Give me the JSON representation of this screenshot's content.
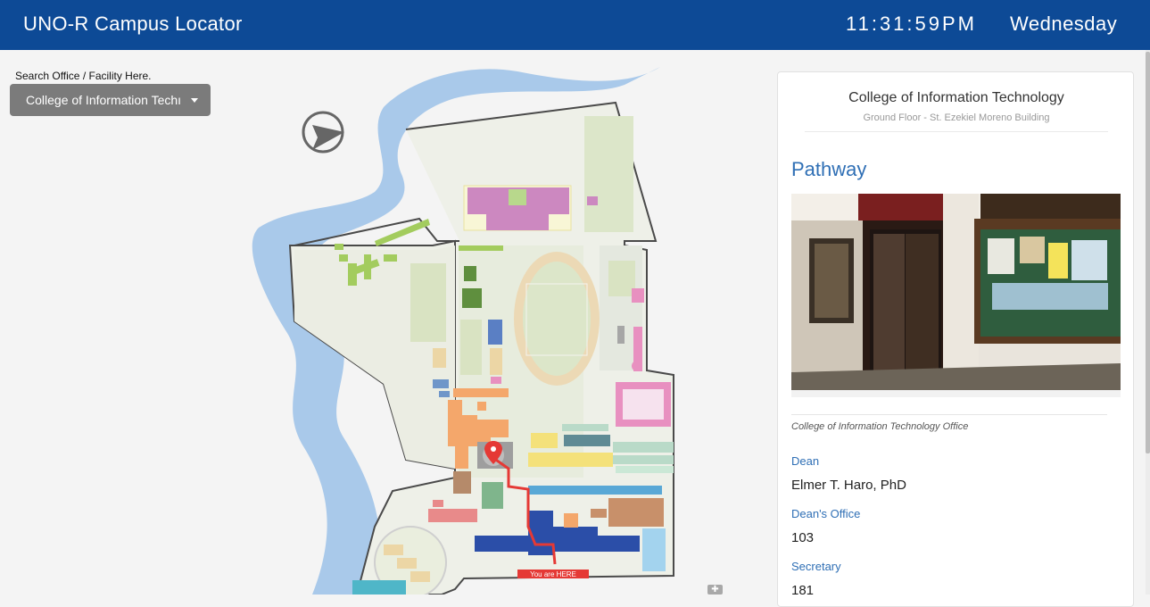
{
  "header": {
    "title": "UNO-R Campus Locator",
    "time": "11:31:59PM",
    "day": "Wednesday"
  },
  "search": {
    "label": "Search Office / Facility Here.",
    "selected": "College of Information Techı"
  },
  "map": {
    "you_are_here": "You are HERE"
  },
  "details": {
    "office_name": "College of Information Technology",
    "location": "Ground Floor - St. Ezekiel Moreno Building",
    "section_title": "Pathway",
    "photo_caption": "College of Information Technology Office",
    "fields": [
      {
        "label": "Dean",
        "value": "Elmer T. Haro, PhD"
      },
      {
        "label": "Dean's Office",
        "value": "103"
      },
      {
        "label": "Secretary",
        "value": "181"
      }
    ]
  },
  "colors": {
    "header_bg": "#0d4a96",
    "accent_blue": "#2f6fb5",
    "dropdown_bg": "#7b7b7b",
    "route_red": "#e53935",
    "river": "#a9c9ea"
  },
  "icons": {
    "compass": "compass-icon",
    "location_pin": "location-pin-icon",
    "caret": "caret-down-icon",
    "zoom": "zoom-icon"
  }
}
